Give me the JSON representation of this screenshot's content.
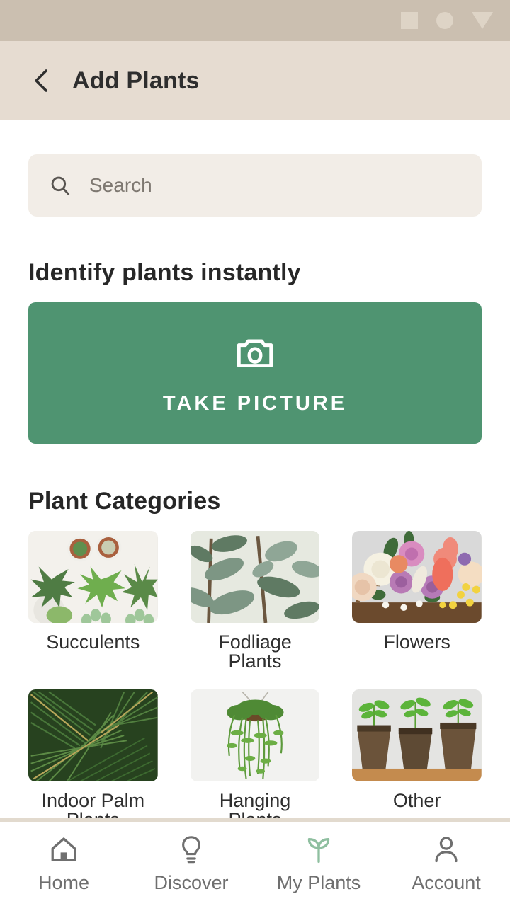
{
  "statusbar": {
    "icons": [
      "square-icon",
      "circle-icon",
      "triangle-down-icon"
    ],
    "background": "#cbbfb0"
  },
  "appbar": {
    "back_icon": "chevron-left-icon",
    "title": "Add Plants",
    "background": "#e6dcd1"
  },
  "search": {
    "icon": "search-icon",
    "placeholder": "Search",
    "value": "",
    "background": "#f2ede7"
  },
  "identify": {
    "heading": "Identify plants instantly",
    "button_label": "TAKE PICTURE",
    "button_icon": "camera-icon",
    "button_color": "#4f9471"
  },
  "categories": {
    "heading": "Plant Categories",
    "items": [
      {
        "label": "Succulents",
        "image": "succulents-photo"
      },
      {
        "label": "Fodliage Plants",
        "image": "foliage-plants-photo"
      },
      {
        "label": "Flowers",
        "image": "flowers-photo"
      },
      {
        "label": "Indoor Palm Plants",
        "image": "indoor-palm-plants-photo"
      },
      {
        "label": "Hanging Plants",
        "image": "hanging-plants-photo"
      },
      {
        "label": "Other",
        "image": "seedlings-photo"
      }
    ]
  },
  "bottomnav": {
    "active_color": "#8fbfa0",
    "inactive_color": "#6f6f6f",
    "items": [
      {
        "label": "Home",
        "icon": "home-icon",
        "active": false
      },
      {
        "label": "Discover",
        "icon": "lightbulb-icon",
        "active": false
      },
      {
        "label": "My Plants",
        "icon": "sprout-icon",
        "active": true
      },
      {
        "label": "Account",
        "icon": "person-icon",
        "active": false
      }
    ]
  }
}
